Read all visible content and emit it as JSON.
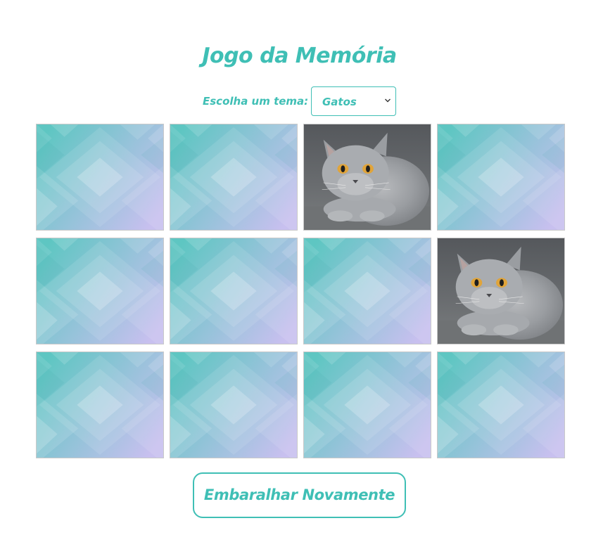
{
  "header": {
    "title": "Jogo da Memória"
  },
  "theme": {
    "label": "Escolha um tema:",
    "selected": "Gatos"
  },
  "board": {
    "rows": 3,
    "columns": 4,
    "cards": [
      {
        "state": "face-down"
      },
      {
        "state": "face-down"
      },
      {
        "state": "face-up",
        "image": "gray-cat"
      },
      {
        "state": "face-down"
      },
      {
        "state": "face-down"
      },
      {
        "state": "face-down"
      },
      {
        "state": "face-down"
      },
      {
        "state": "face-up",
        "image": "gray-cat"
      },
      {
        "state": "face-down"
      },
      {
        "state": "face-down"
      },
      {
        "state": "face-down"
      },
      {
        "state": "face-down"
      }
    ]
  },
  "actions": {
    "reshuffle_label": "Embaralhar Novamente"
  },
  "colors": {
    "accent": "#3fbfb5",
    "card_back_start": "#5ec6c2",
    "card_back_end": "#c8c0ef"
  },
  "icons": {
    "select_arrow": "chevron-down-icon"
  }
}
